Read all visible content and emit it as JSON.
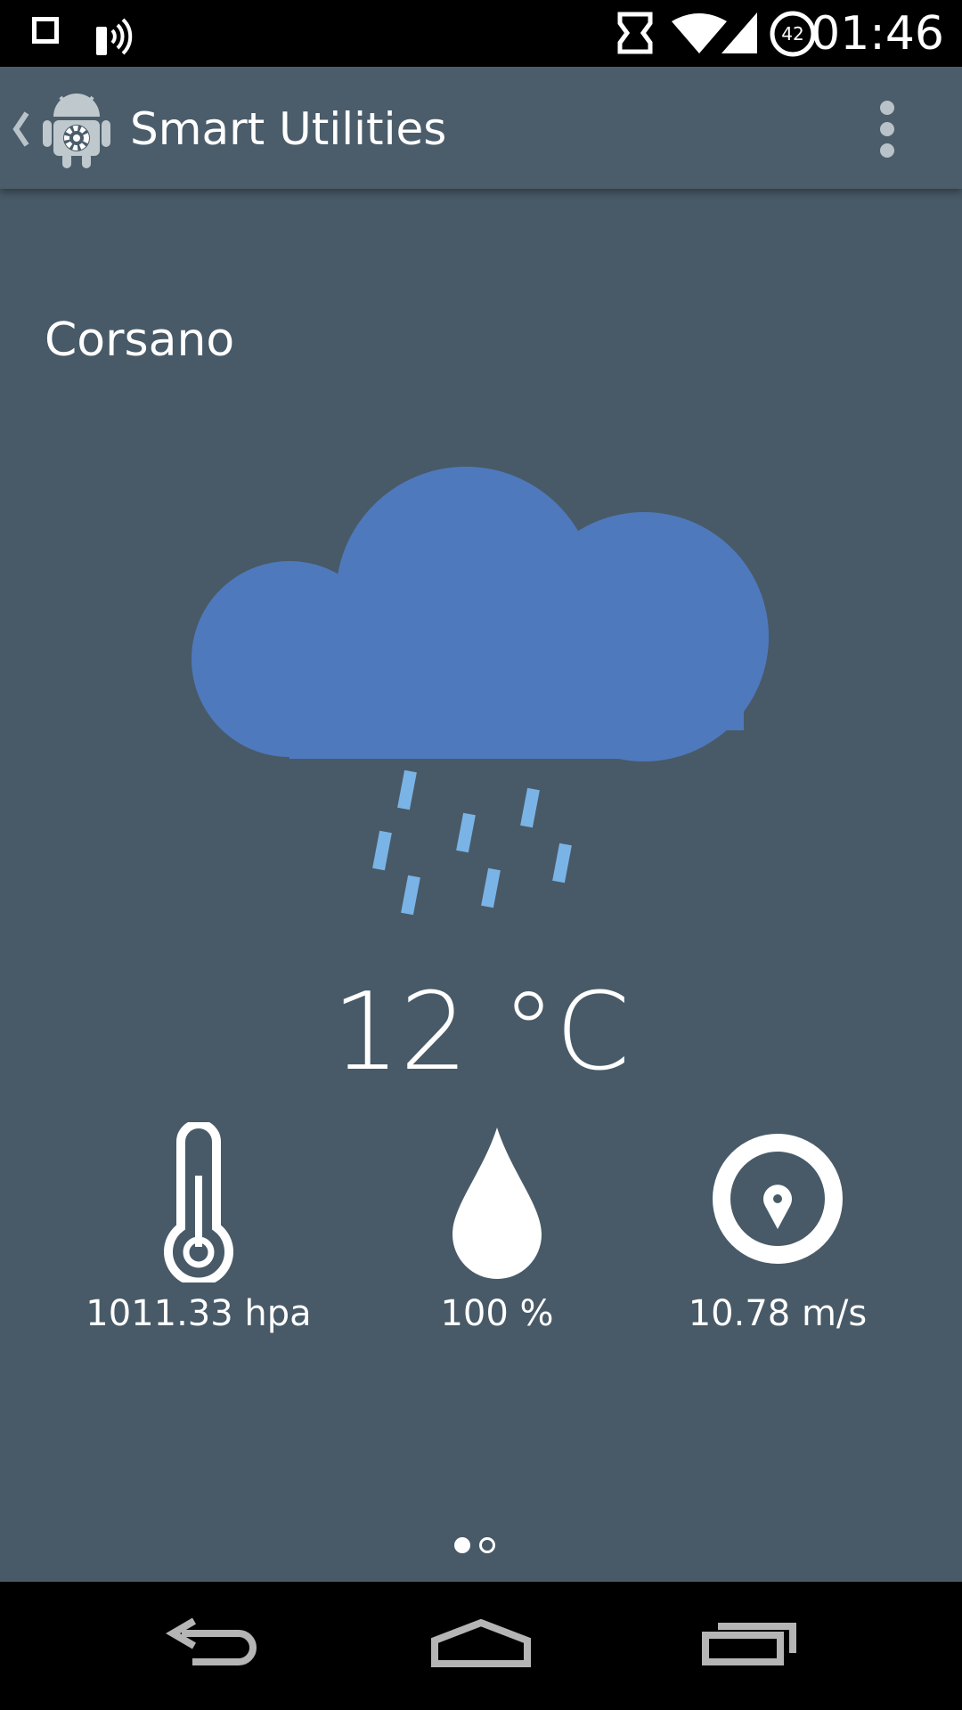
{
  "status_bar": {
    "clock": "01:46",
    "battery_level": "42",
    "icons": [
      "square-notification-icon",
      "broadcast-icon",
      "sync-icon",
      "wifi-icon",
      "signal-icon",
      "battery-icon"
    ]
  },
  "action_bar": {
    "title": "Smart Utilities",
    "icons": [
      "back-chevron-icon",
      "app-android-gear-icon",
      "overflow-menu-icon"
    ]
  },
  "weather": {
    "city": "Corsano",
    "condition_icon": "rain-cloud-icon",
    "temperature": "12 °C",
    "pressure": "1011.33 hpa",
    "humidity": "100 %",
    "wind": "10.78 m/s"
  },
  "pager": {
    "current_page": 1,
    "total_pages": 2
  },
  "colors": {
    "background": "#485a67",
    "cloud": "#4f79bd",
    "rain": "#7ab4e6",
    "text": "#ffffff"
  }
}
